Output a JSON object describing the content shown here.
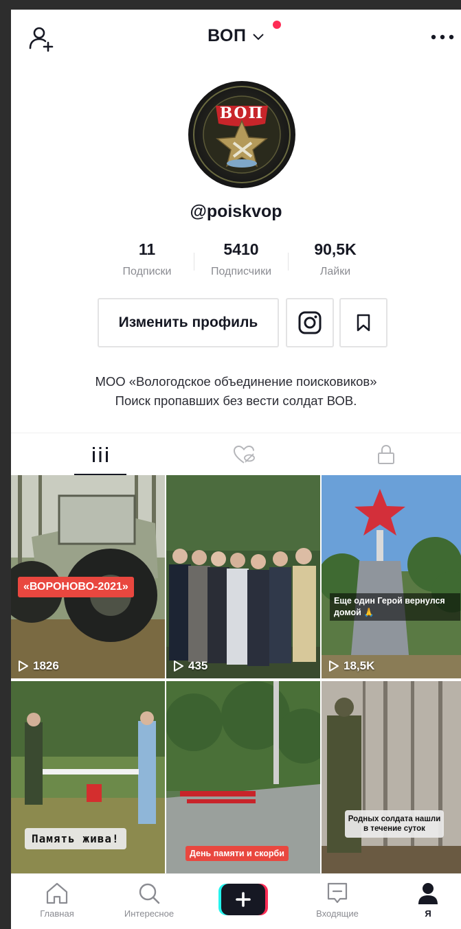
{
  "header": {
    "title": "ВОП"
  },
  "profile": {
    "username": "@poiskvop",
    "avatar_text": "ВОП",
    "stats": [
      {
        "value": "11",
        "label": "Подписки"
      },
      {
        "value": "5410",
        "label": "Подписчики"
      },
      {
        "value": "90,5K",
        "label": "Лайки"
      }
    ],
    "edit_label": "Изменить профиль",
    "bio_lines": [
      "МОО «Вологодское объединение поисковиков»",
      "Поиск пропавших без вести солдат ВОВ."
    ]
  },
  "videos": [
    {
      "views": "1826",
      "caption": "«ВОРОНОВО-2021»"
    },
    {
      "views": "435",
      "caption": ""
    },
    {
      "views": "18,5K",
      "caption": "Еще один Герой вернулся домой 🙏"
    },
    {
      "views": "",
      "caption": "Память жива!"
    },
    {
      "views": "",
      "caption": "День памяти и скорби"
    },
    {
      "views": "",
      "caption": "Родных солдата нашли в течение суток"
    }
  ],
  "nav": {
    "home": "Главная",
    "discover": "Интересное",
    "inbox": "Входящие",
    "me": "Я"
  },
  "colors": {
    "accent": "#fe2c55",
    "caption_red": "#e9473f",
    "text": "#161823",
    "muted": "#8a8b91"
  }
}
